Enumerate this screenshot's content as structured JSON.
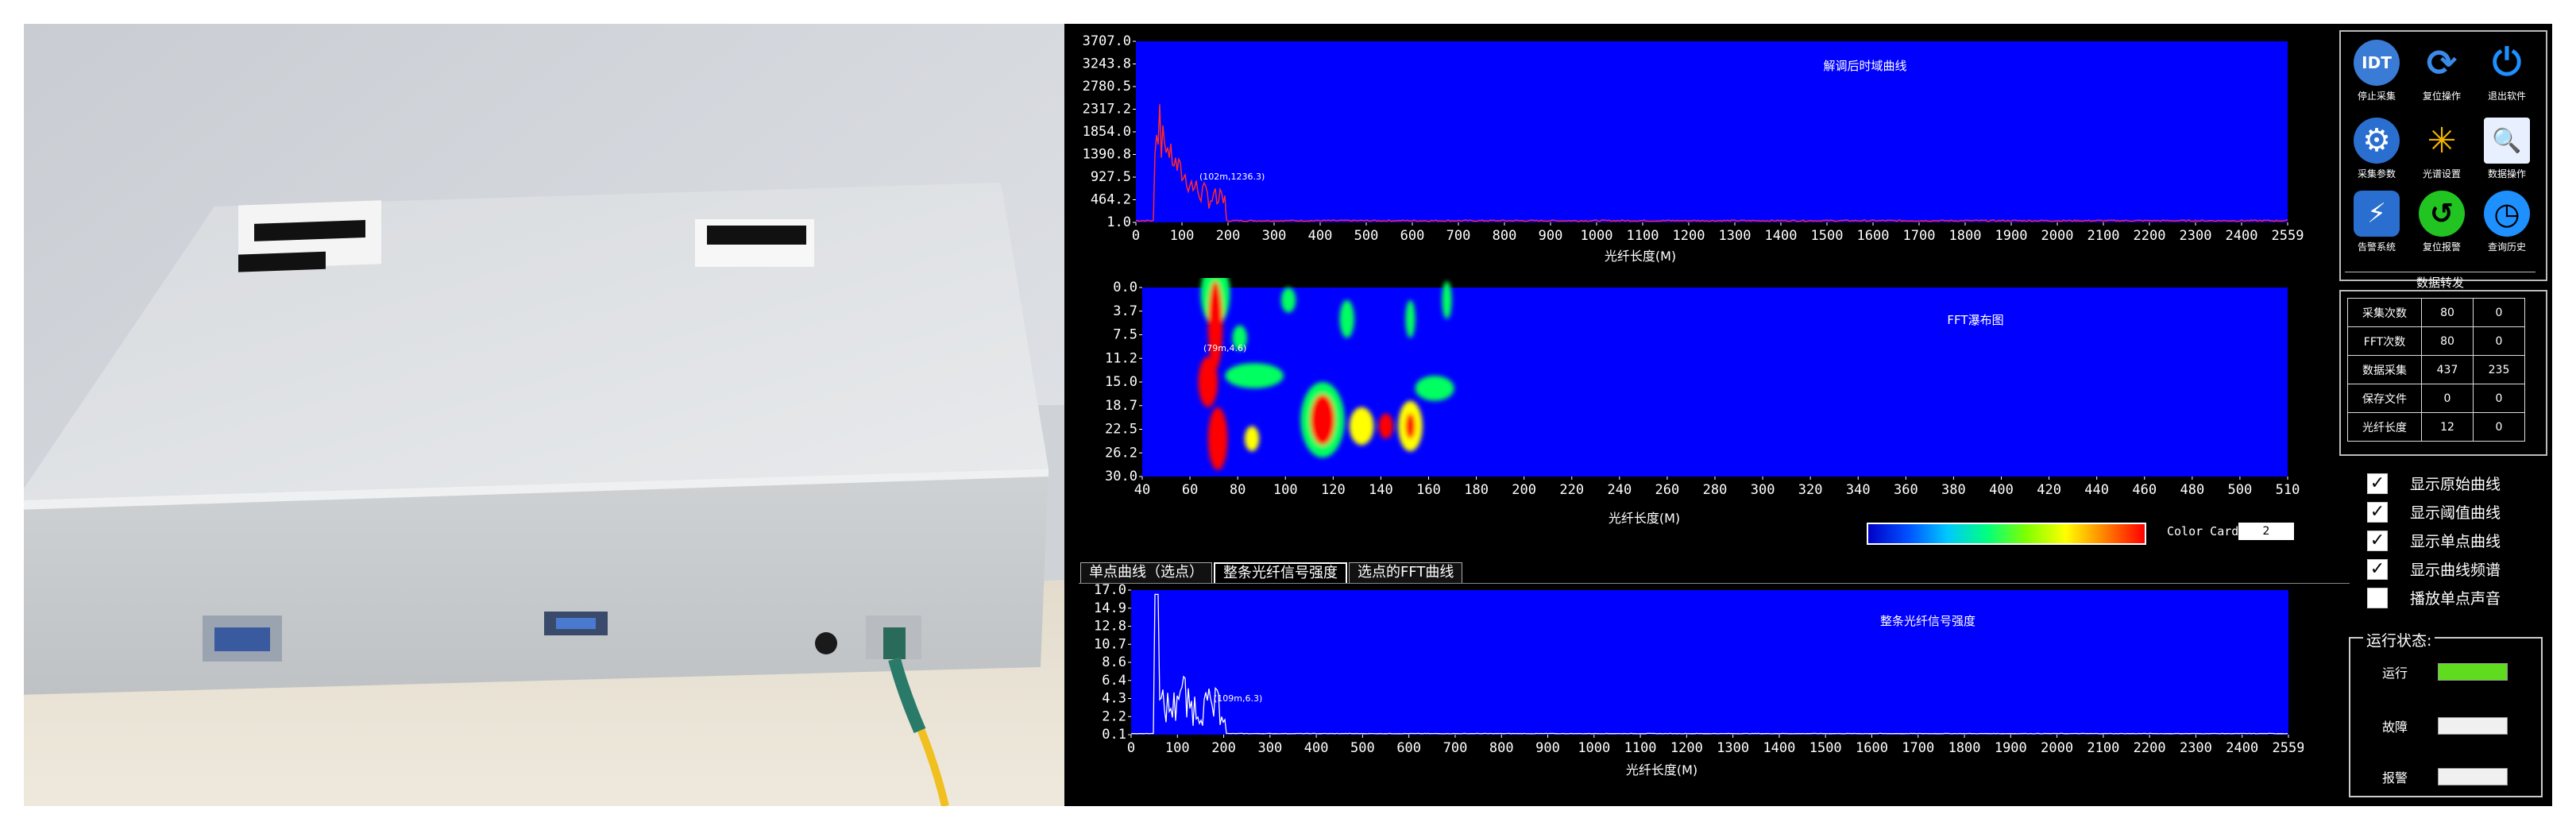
{
  "ui": {
    "plot1": {
      "title": "解调后时域曲线",
      "xlabel": "光纤长度(M)",
      "marker": "(102m,1236.3)",
      "y_ticks": [
        "3707.0",
        "3243.8",
        "2780.5",
        "2317.2",
        "1854.0",
        "1390.8",
        "927.5",
        "464.2",
        "1.0"
      ],
      "x_ticks": [
        "0",
        "100",
        "200",
        "300",
        "400",
        "500",
        "600",
        "700",
        "800",
        "900",
        "1000",
        "1100",
        "1200",
        "1300",
        "1400",
        "1500",
        "1600",
        "1700",
        "1800",
        "1900",
        "2000",
        "2100",
        "2200",
        "2300",
        "2400",
        "2559"
      ]
    },
    "plot2": {
      "title": "FFT瀑布图",
      "xlabel": "光纤长度(M)",
      "marker": "(79m,4.6)",
      "y_ticks": [
        "0.0",
        "3.7",
        "7.5",
        "11.2",
        "15.0",
        "18.7",
        "22.5",
        "26.2",
        "30.0"
      ],
      "x_ticks": [
        "40",
        "60",
        "80",
        "100",
        "120",
        "140",
        "160",
        "180",
        "200",
        "220",
        "240",
        "260",
        "280",
        "300",
        "320",
        "340",
        "360",
        "380",
        "400",
        "420",
        "440",
        "460",
        "480",
        "500",
        "510"
      ]
    },
    "plot3": {
      "title": "整条光纤信号强度",
      "xlabel": "光纤长度(M)",
      "marker": "(109m,6.3)",
      "y_ticks": [
        "17.0",
        "14.9",
        "12.8",
        "10.7",
        "8.6",
        "6.4",
        "4.3",
        "2.2",
        "0.1"
      ],
      "x_ticks": [
        "0",
        "100",
        "200",
        "300",
        "400",
        "500",
        "600",
        "700",
        "800",
        "900",
        "1000",
        "1100",
        "1200",
        "1300",
        "1400",
        "1500",
        "1600",
        "1700",
        "1800",
        "1900",
        "2000",
        "2100",
        "2200",
        "2300",
        "2400",
        "2559"
      ]
    },
    "color_card": {
      "label": "Color Card",
      "value": "2"
    },
    "tabs": [
      {
        "label": "单点曲线（选点）"
      },
      {
        "label": "整条光纤信号强度"
      },
      {
        "label": "选点的FFT曲线"
      }
    ],
    "buttons": [
      {
        "label": "停止采集",
        "glyph": "IDT",
        "icon": "stop-acquisition-icon",
        "color": "#3a7bd5"
      },
      {
        "label": "复位操作",
        "glyph": "⟳",
        "icon": "reset-icon",
        "color": "#1e4fa0"
      },
      {
        "label": "退出软件",
        "glyph": "⏻",
        "icon": "power-icon",
        "color": "#1e90ff"
      },
      {
        "label": "采集参数",
        "glyph": "⚙",
        "icon": "gear-icon",
        "color": "#2a6fd0"
      },
      {
        "label": "光谱设置",
        "glyph": "✳",
        "icon": "spectrum-icon",
        "color": "#f0b400"
      },
      {
        "label": "数据操作",
        "glyph": "🔍",
        "icon": "data-search-icon",
        "color": "#e8f0ff"
      },
      {
        "label": "告警系统",
        "glyph": "⚡",
        "icon": "alarm-icon",
        "color": "#2a6fd0"
      },
      {
        "label": "复位报警",
        "glyph": "↺",
        "icon": "reset-alarm-icon",
        "color": "#22c422"
      },
      {
        "label": "查询历史",
        "glyph": "◷",
        "icon": "history-icon",
        "color": "#1e90ff"
      }
    ],
    "forward_label": "数据转发",
    "stats": [
      {
        "label": "采集次数",
        "v1": "80",
        "v2": "0"
      },
      {
        "label": "FFT次数",
        "v1": "80",
        "v2": "0"
      },
      {
        "label": "数据采集",
        "v1": "437",
        "v2": "235"
      },
      {
        "label": "保存文件",
        "v1": "0",
        "v2": "0"
      },
      {
        "label": "光纤长度",
        "v1": "12",
        "v2": "0"
      }
    ],
    "checks": [
      {
        "label": "显示原始曲线",
        "checked": true
      },
      {
        "label": "显示阈值曲线",
        "checked": true
      },
      {
        "label": "显示单点曲线",
        "checked": true
      },
      {
        "label": "显示曲线频谱",
        "checked": true
      },
      {
        "label": "播放单点声音",
        "checked": false
      }
    ],
    "status": {
      "title": "运行状态:",
      "items": [
        {
          "label": "运行",
          "color": "#5fdc1e"
        },
        {
          "label": "故障",
          "color": "#f0f0f0"
        },
        {
          "label": "报警",
          "color": "#f0f0f0"
        }
      ]
    }
  }
}
